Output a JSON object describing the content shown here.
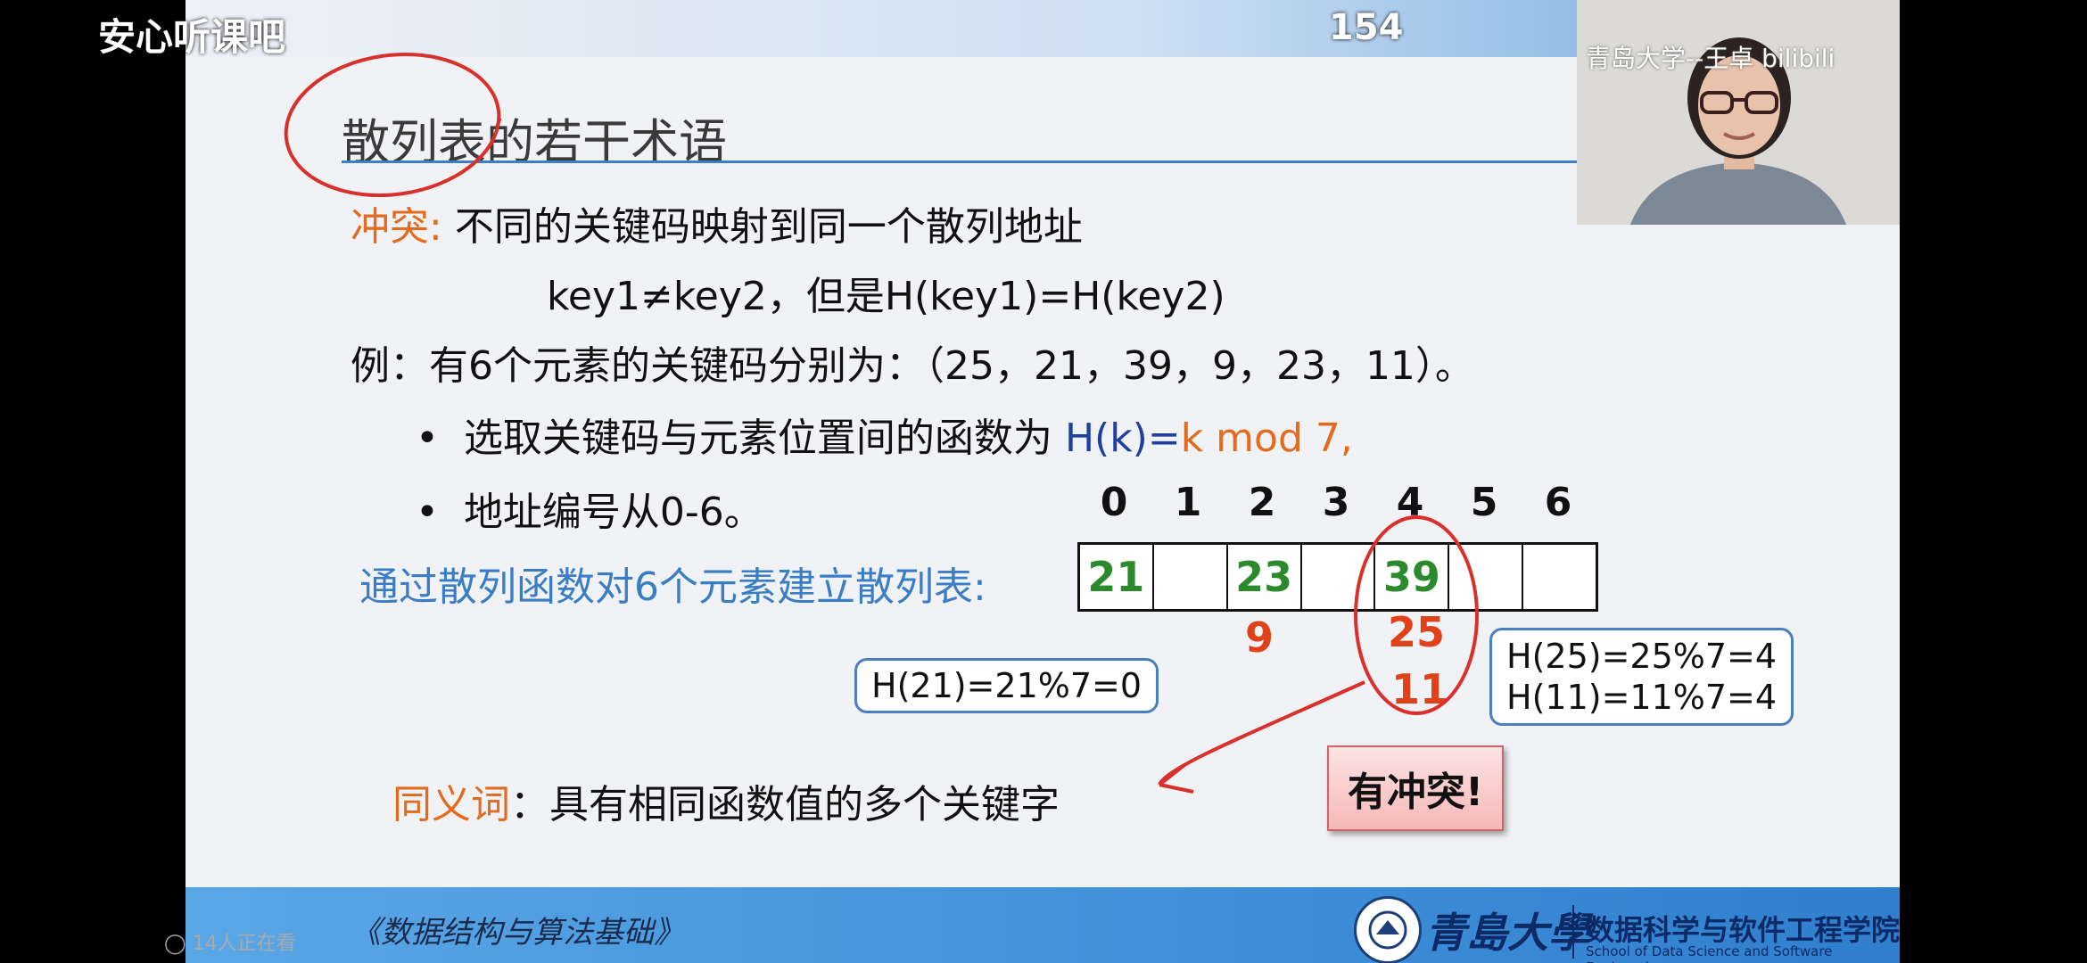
{
  "app": {
    "title": "安心听课吧",
    "page_number": "154",
    "watching": "14人正在看"
  },
  "webcam": {
    "label": "青岛大学--王卓 bilibili"
  },
  "slide": {
    "title": "散列表的若干术语",
    "conflict_term": "冲突:",
    "conflict_def": "不同的关键码映射到同一个散列地址",
    "conflict_formula": "key1≠key2，但是H(key1)=H(key2)",
    "example": "例：有6个元素的关键码分别为：（25，21，39，9，23，11）。",
    "bullet1_prefix": "选取关键码与元素位置间的函数为",
    "bullet1_fn": "H(k)=",
    "bullet1_expr": "k mod 7,",
    "bullet2": "地址编号从0-6。",
    "build_text": "通过散列函数对6个元素建立散列表:",
    "indices": [
      "0",
      "1",
      "2",
      "3",
      "4",
      "5",
      "6"
    ],
    "cells": [
      "21",
      "",
      "23",
      "",
      "39",
      "",
      ""
    ],
    "below_2": "9",
    "below_4a": "25",
    "below_4b": "11",
    "bubble_left": "H(21)=21%7=0",
    "bubble_right_1": "H(25)=25%7=4",
    "bubble_right_2": "H(11)=11%7=4",
    "synonym_term": "同义词",
    "synonym_def": "：具有相同函数值的多个关键字",
    "conflict_badge": "有冲突!"
  },
  "footer": {
    "book": "《数据结构与算法基础》",
    "university": "青島大學",
    "school_cn": "数据科学与软件工程学院",
    "school_en": "School of Data Science and Software Engineering"
  },
  "colors": {
    "accent_orange": "#e26b1d",
    "accent_blue": "#1f3fa0",
    "cell_green": "#2b8a2b",
    "red": "#e0401a",
    "bar_blue": "#3f8fd9"
  }
}
